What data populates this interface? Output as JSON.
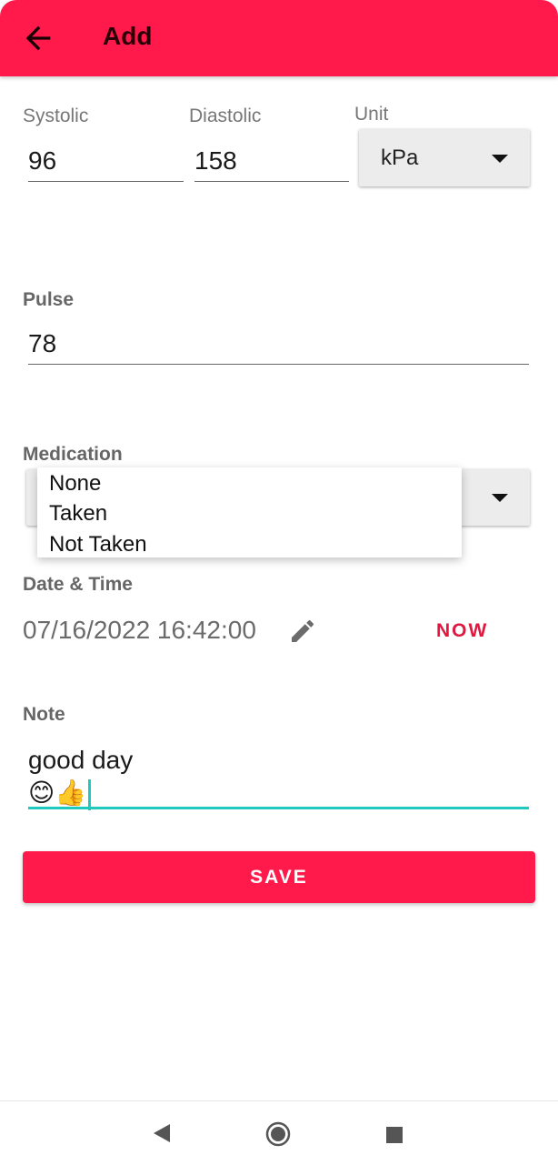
{
  "app_bar": {
    "title": "Add",
    "back_icon": "arrow-left-icon",
    "color": "#FF1A4B"
  },
  "blood_pressure": {
    "systolic_label": "Systolic",
    "systolic_value": "96",
    "diastolic_label": "Diastolic",
    "diastolic_value": "158",
    "unit_label": "Unit",
    "unit_value": "kPa"
  },
  "pulse": {
    "label": "Pulse",
    "value": "78"
  },
  "medication": {
    "label": "Medication",
    "options": [
      "None",
      "Taken",
      "Not Taken"
    ]
  },
  "date_time": {
    "label": "Date & Time",
    "value": "07/16/2022 16:42:00",
    "edit_icon": "pencil-icon",
    "now_label": "NOW"
  },
  "note": {
    "label": "Note",
    "line1": "good day",
    "line2": "😊👍",
    "accent": "#1EC9BD"
  },
  "save_label": "SAVE",
  "nav": {
    "back_icon": "triangle-back-icon",
    "home_icon": "circle-home-icon",
    "recents_icon": "square-recents-icon"
  }
}
